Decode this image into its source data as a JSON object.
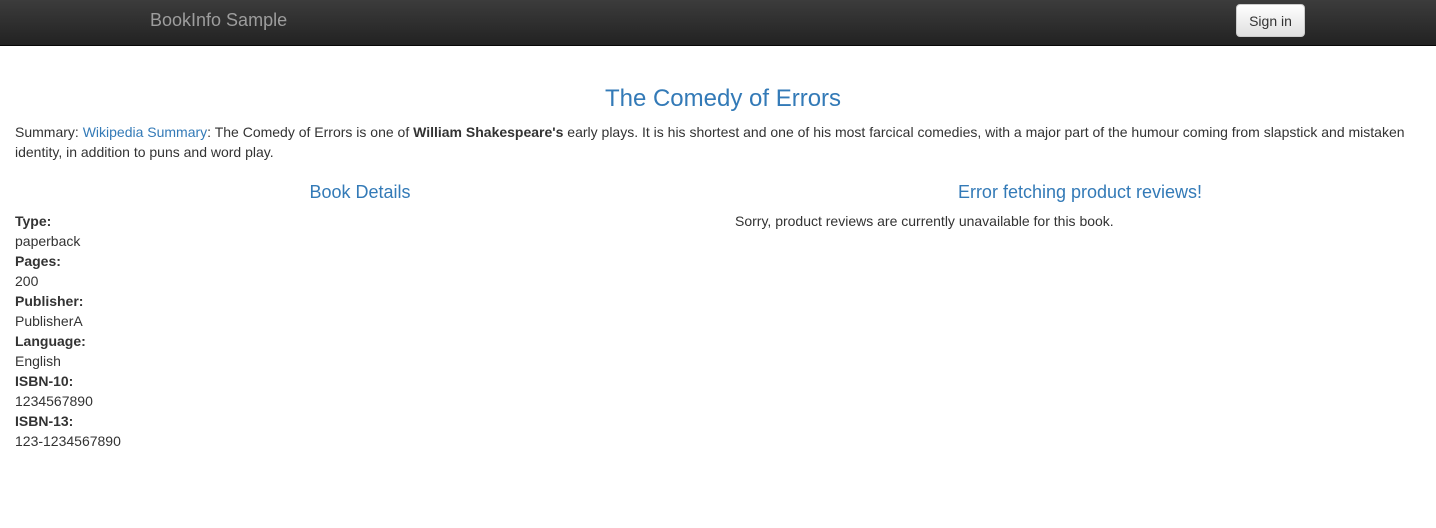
{
  "navbar": {
    "brand": "BookInfo Sample",
    "signin_label": "Sign in"
  },
  "book": {
    "title": "The Comedy of Errors",
    "summary": {
      "prefix": "Summary: ",
      "link_text": "Wikipedia Summary",
      "text_before_bold": ": The Comedy of Errors is one of ",
      "bold_text": "William Shakespeare's",
      "text_after_bold": " early plays. It is his shortest and one of his most farcical comedies, with a major part of the humour coming from slapstick and mistaken identity, in addition to puns and word play."
    }
  },
  "details": {
    "heading": "Book Details",
    "fields": [
      {
        "label": "Type:",
        "value": "paperback"
      },
      {
        "label": "Pages:",
        "value": "200"
      },
      {
        "label": "Publisher:",
        "value": "PublisherA"
      },
      {
        "label": "Language:",
        "value": "English"
      },
      {
        "label": "ISBN-10:",
        "value": "1234567890"
      },
      {
        "label": "ISBN-13:",
        "value": "123-1234567890"
      }
    ]
  },
  "reviews": {
    "heading": "Error fetching product reviews!",
    "message": "Sorry, product reviews are currently unavailable for this book."
  },
  "colors": {
    "accent": "#337ab7",
    "navbar": "#222222",
    "text": "#333333"
  }
}
